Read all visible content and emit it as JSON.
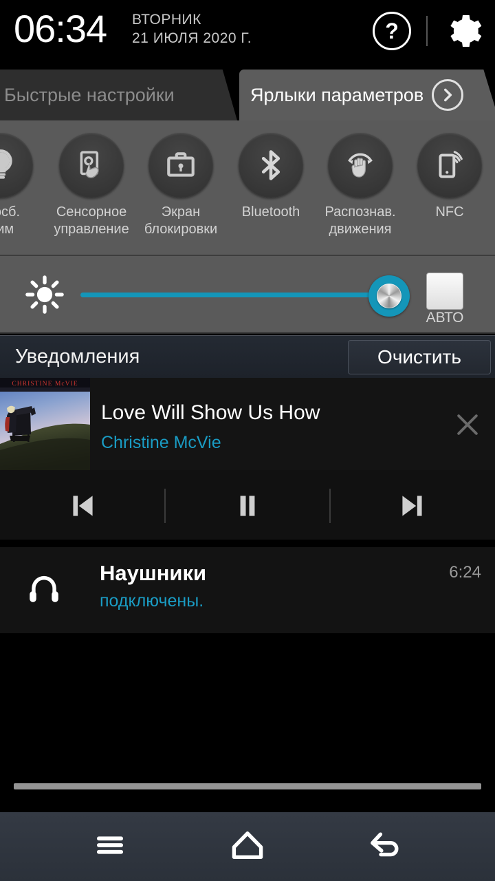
{
  "statusbar": {
    "time": "06:34",
    "weekday": "ВТОРНИК",
    "date": "21 ИЮЛЯ 2020 Г.",
    "help_icon": "question-mark-circle-icon",
    "settings_icon": "gear-icon"
  },
  "tabs": [
    {
      "label": "Быстрые настройки",
      "active": false
    },
    {
      "label": "Ярлыки параметров",
      "active": true,
      "chevron": "chevron-right-circle-icon"
    }
  ],
  "quick_toggles": [
    {
      "label": "огосб.\nжим",
      "label_line1": "огосб.",
      "label_line2": "жим",
      "icon": "power-saving-bulb-icon",
      "enabled": false
    },
    {
      "label_line1": "Сенсорное",
      "label_line2": "управление",
      "icon": "touch-control-icon",
      "enabled": false
    },
    {
      "label_line1": "Экран",
      "label_line2": "блокировки",
      "icon": "briefcase-lock-icon",
      "enabled": false
    },
    {
      "label_line1": "Bluetooth",
      "label_line2": "",
      "icon": "bluetooth-icon",
      "enabled": false
    },
    {
      "label_line1": "Распознав.",
      "label_line2": "движения",
      "icon": "motion-hand-icon",
      "enabled": false
    },
    {
      "label_line1": "NFC",
      "label_line2": "",
      "icon": "nfc-phone-icon",
      "enabled": false
    }
  ],
  "brightness": {
    "icon": "brightness-sun-icon",
    "value_percent": 100,
    "accent_color": "#1496b9",
    "auto_label": "АВТО",
    "auto_checked": false
  },
  "notifications_header": {
    "title": "Уведомления",
    "clear_label": "Очистить"
  },
  "media": {
    "title": "Love Will Show Us How",
    "artist": "Christine McVie",
    "album_art_text": "CHRISTINE McVIE",
    "close_icon": "close-x-icon",
    "controls": [
      {
        "name": "previous",
        "icon": "skip-previous-icon"
      },
      {
        "name": "pause",
        "icon": "pause-icon"
      },
      {
        "name": "next",
        "icon": "skip-next-icon"
      }
    ],
    "artist_color": "#1a9cc4"
  },
  "headphones": {
    "icon": "headphones-icon",
    "title": "Наушники",
    "subtitle": "подключены.",
    "time": "6:24",
    "subtitle_color": "#1a9cc4"
  },
  "navbar": [
    {
      "name": "menu",
      "icon": "hamburger-menu-icon"
    },
    {
      "name": "home",
      "icon": "home-icon"
    },
    {
      "name": "back",
      "icon": "back-arrow-icon"
    }
  ]
}
